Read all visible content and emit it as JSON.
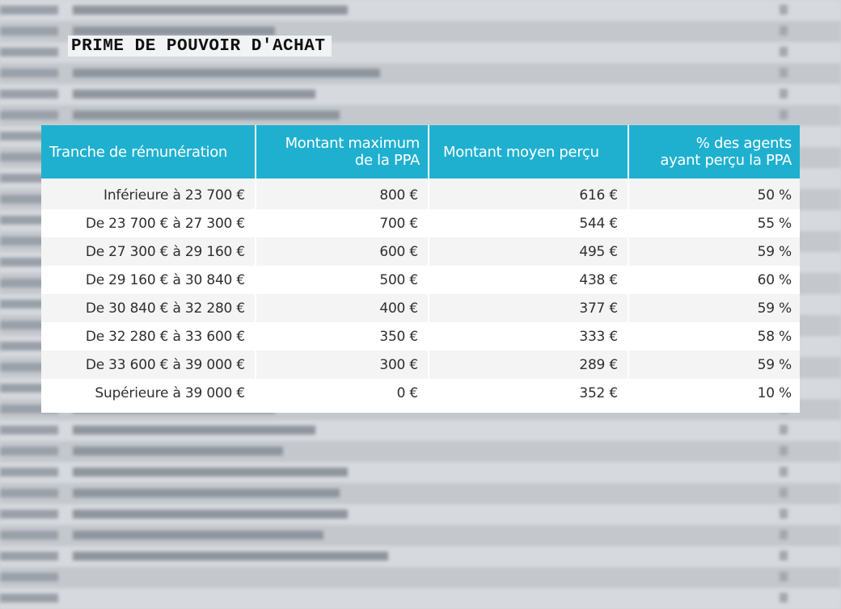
{
  "title": "PRIME DE POUVOIR D'ACHAT",
  "table": {
    "headers": [
      "Tranche de rémunération",
      "Montant maximum de la PPA",
      "Montant moyen perçu",
      "% des agents ayant perçu la PPA"
    ],
    "header_lines": [
      [
        "Tranche de rémunération"
      ],
      [
        "Montant maximum",
        "de la PPA"
      ],
      [
        "Montant moyen perçu"
      ],
      [
        "% des agents",
        "ayant perçu la PPA"
      ]
    ],
    "rows": [
      [
        "Inférieure à 23 700 €",
        "800 €",
        "616 €",
        "50 %"
      ],
      [
        "De 23 700 € à 27 300 €",
        "700 €",
        "544 €",
        "55 %"
      ],
      [
        "De 27 300 € à 29 160 €",
        "600 €",
        "495 €",
        "59 %"
      ],
      [
        "De 29 160 € à 30 840 €",
        "500 €",
        "438 €",
        "60 %"
      ],
      [
        "De 30 840 € à 32 280 €",
        "400 €",
        "377 €",
        "59 %"
      ],
      [
        "De 32 280 € à 33 600 €",
        "350 €",
        "333 €",
        "58 %"
      ],
      [
        "De 33 600 € à 39 000 €",
        "300 €",
        "289 €",
        "59 %"
      ],
      [
        "Supérieure à 39 000 €",
        "0 €",
        "352 €",
        "10 %"
      ]
    ]
  },
  "colors": {
    "header_bg": "#1fb0d0",
    "header_text": "#ffffff",
    "row_alt": "#f4f4f4",
    "row": "#ffffff"
  }
}
